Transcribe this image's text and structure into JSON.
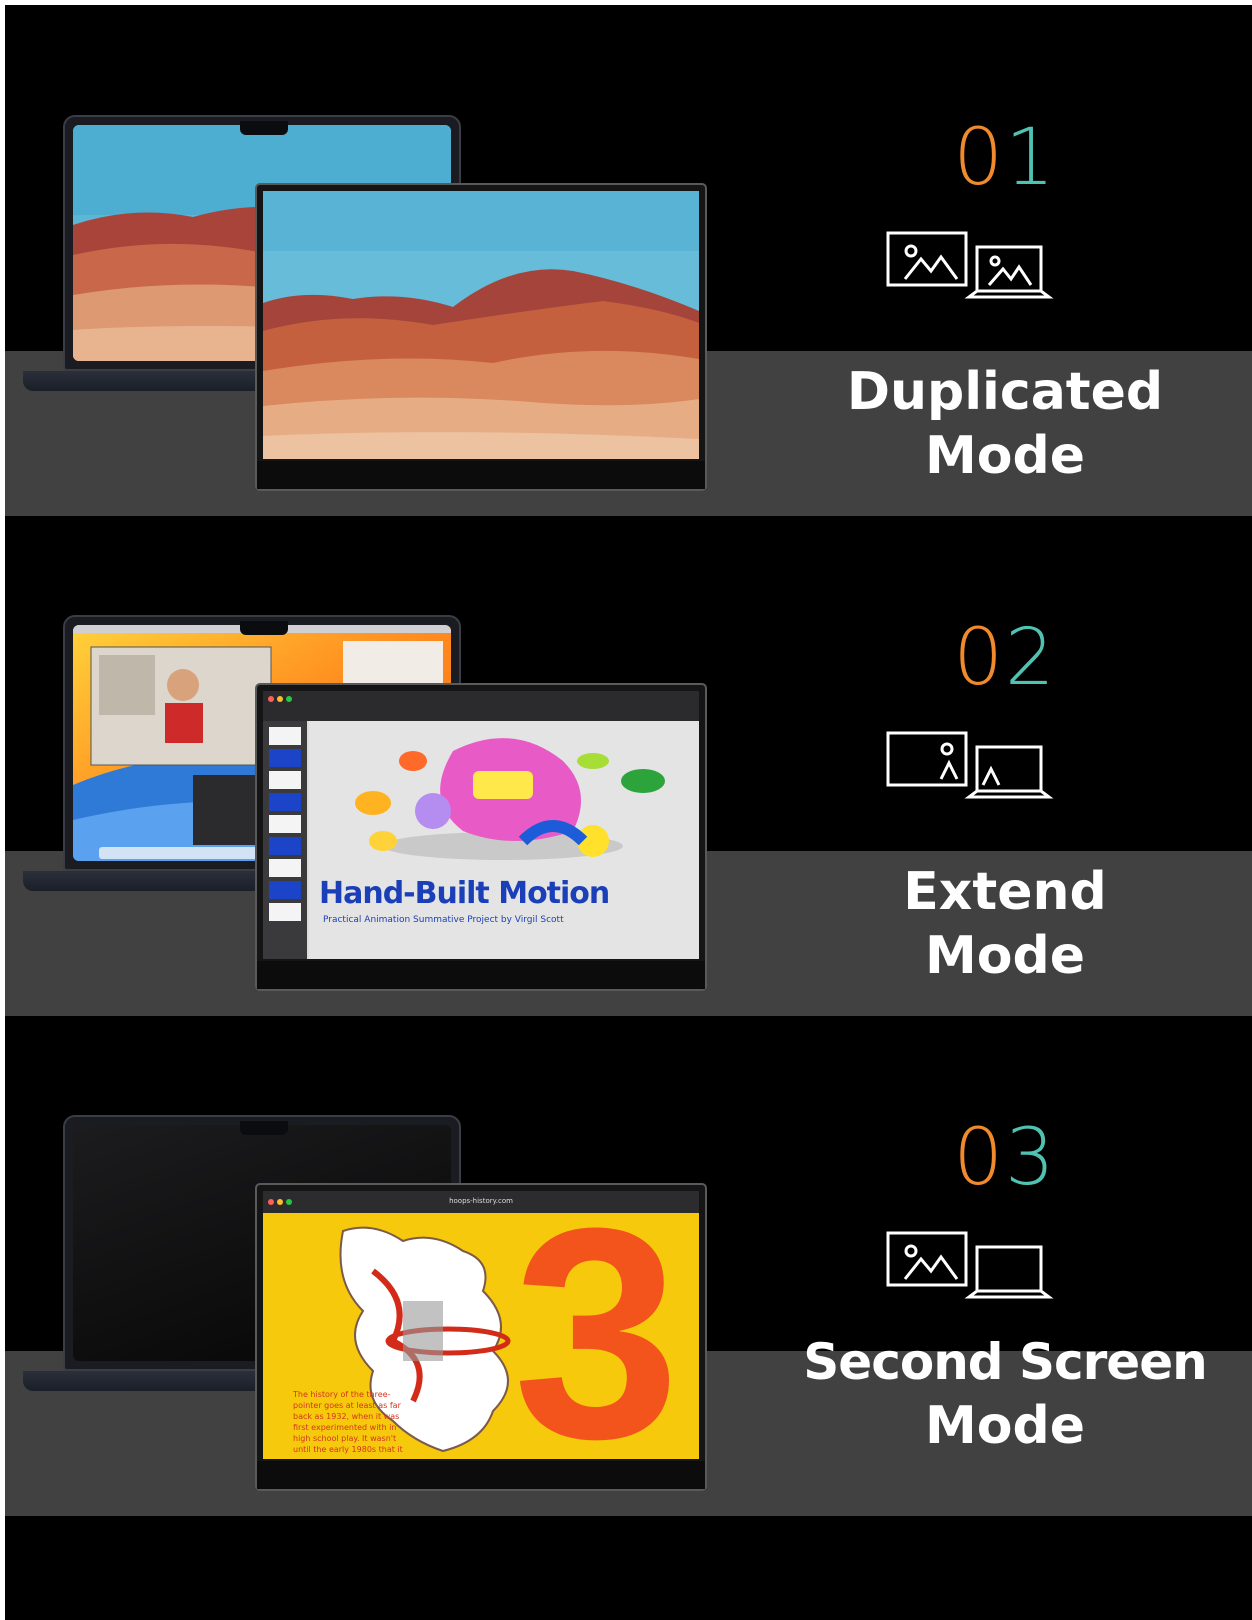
{
  "modes": [
    {
      "number_first": "0",
      "number_second": "1",
      "title_line1": "Duplicated",
      "title_line2": "Mode"
    },
    {
      "number_first": "0",
      "number_second": "2",
      "title_line1": "Extend",
      "title_line2": "Mode",
      "screen": {
        "heading": "Hand-Built Motion",
        "subheading": "Practical Animation Summative Project by Virgil Scott"
      }
    },
    {
      "number_first": "0",
      "number_second": "3",
      "title_line1": "Second Screen",
      "title_line2": "Mode",
      "screen": {
        "url": "hoops-history.com",
        "big_number": "3",
        "body_text": "The history of the three-pointer goes at least as far back as 1932, when it was first experimented with in high school play. It wasn't until the early 1980s that it"
      }
    }
  ],
  "colors": {
    "background": "#000000",
    "band": "#414141",
    "number_orange": "#f08a2c",
    "number_teal": "#4fc2b2",
    "title": "#ffffff"
  },
  "icons": [
    "monitor-image-icon",
    "laptop-image-icon",
    "laptop-blank-icon"
  ]
}
